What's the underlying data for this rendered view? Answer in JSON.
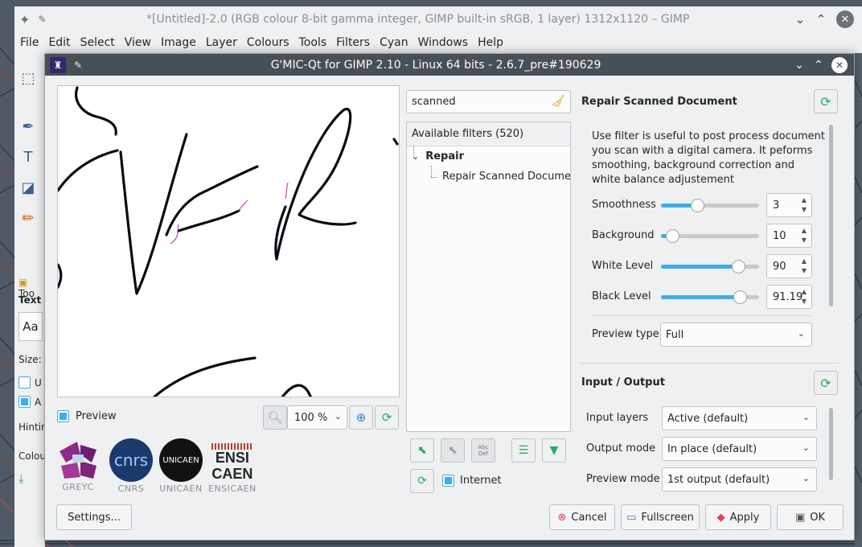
{
  "gimp": {
    "window_title": "*[Untitled]-2.0 (RGB colour 8-bit gamma integer, GIMP built-in sRGB, 1 layer) 1312x1120 – GIMP",
    "menu": [
      "File",
      "Edit",
      "Select",
      "View",
      "Image",
      "Layer",
      "Colours",
      "Tools",
      "Filters",
      "Cyan",
      "Windows",
      "Help"
    ],
    "toolbox": {
      "tab_label": "Too",
      "text_label": "Text",
      "font_sample": "Aa",
      "size_label": "Size:",
      "u_label": "U",
      "a_label": "A",
      "hinting_label": "Hintin",
      "colour_label": "Colou"
    }
  },
  "dialog": {
    "title": "G'MIC-Qt for GIMP 2.10 - Linux 64 bits - 2.6.7_pre#190629",
    "preview": {
      "checkbox_label": "Preview",
      "checked": true,
      "zoom_value": "100 %"
    },
    "logos": [
      {
        "caption": "GREYC"
      },
      {
        "caption": "CNRS",
        "mark": "cnrs"
      },
      {
        "caption": "UNICAEN",
        "mark": "UNICAEN"
      },
      {
        "caption": "ENSICAEN",
        "mark_line1": "ENSI",
        "mark_line2": "CAEN"
      }
    ],
    "filters": {
      "search_value": "scanned",
      "header": "Available filters (520)",
      "category": "Repair",
      "item": "Repair Scanned Document",
      "internet_label": "Internet",
      "internet_checked": true,
      "abc_label_1": "Abc",
      "abc_label_2": "Def"
    },
    "filter_panel": {
      "title": "Repair Scanned Document",
      "description": "Use filter is useful to post process document you scan with a digital camera. It peforms smoothing, background correction and white balance adjustement",
      "params": [
        {
          "label": "Smoothness",
          "value": "3",
          "fraction": 0.35
        },
        {
          "label": "Background",
          "value": "10",
          "fraction": 0.06
        },
        {
          "label": "White Level",
          "value": "90",
          "fraction": 0.84
        },
        {
          "label": "Black Level",
          "value": "91.19",
          "fraction": 0.86
        }
      ],
      "preview_type_label": "Preview type",
      "preview_type_value": "Full"
    },
    "io": {
      "title": "Input / Output",
      "input_layers_label": "Input layers",
      "input_layers_value": "Active (default)",
      "output_mode_label": "Output mode",
      "output_mode_value": "In place (default)",
      "preview_mode_label": "Preview mode",
      "preview_mode_value": "1st output (default)"
    },
    "buttons": {
      "settings": "Settings...",
      "cancel": "Cancel",
      "fullscreen": "Fullscreen",
      "apply": "Apply",
      "ok": "OK"
    }
  },
  "colors": {
    "accent": "#3daee9",
    "titlebar": "#475057",
    "window_bg": "#eff0f1",
    "refresh_green": "#27ae60"
  },
  "icons": [
    "gimp-icon",
    "pin-icon",
    "minimize-icon",
    "maximize-icon",
    "close-icon",
    "zoom-out-icon",
    "zoom-in-icon",
    "refresh-icon",
    "clear-search-icon",
    "add-fave-icon",
    "remove-fave-icon",
    "rename-fave-icon",
    "expand-all-icon",
    "download-icon",
    "cancel-icon",
    "fullscreen-icon",
    "apply-icon",
    "ok-icon"
  ]
}
